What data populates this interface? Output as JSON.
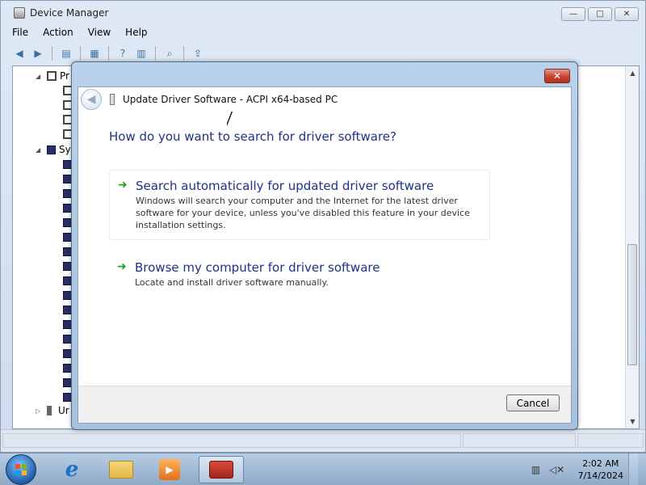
{
  "device_manager": {
    "title": "Device Manager",
    "menu": [
      "File",
      "Action",
      "View",
      "Help"
    ],
    "controls": {
      "minimize": "—",
      "maximize": "□",
      "close": "✕"
    },
    "tree": {
      "node1_label": "Pr",
      "node2_label": "Sy",
      "node3_label": "Ur"
    }
  },
  "dialog": {
    "title": "Update Driver Software - ACPI x64-based PC",
    "close_glyph": "✕",
    "question": "How do you want to search for driver software?",
    "options": [
      {
        "icon": "green-arrow-icon",
        "title": "Search automatically for updated driver software",
        "description": "Windows will search your computer and the Internet for the latest driver software for your device, unless you've disabled this feature in your device installation settings."
      },
      {
        "icon": "green-arrow-icon",
        "title": "Browse my computer for driver software",
        "description": "Locate and install driver software manually."
      }
    ],
    "cancel_label": "Cancel"
  },
  "taskbar": {
    "pinned": [
      "internet-explorer-icon",
      "explorer-folder-icon",
      "media-player-icon",
      "device-manager-toolbox-icon"
    ],
    "clock": {
      "time": "2:02 AM",
      "date": "7/14/2024"
    }
  }
}
